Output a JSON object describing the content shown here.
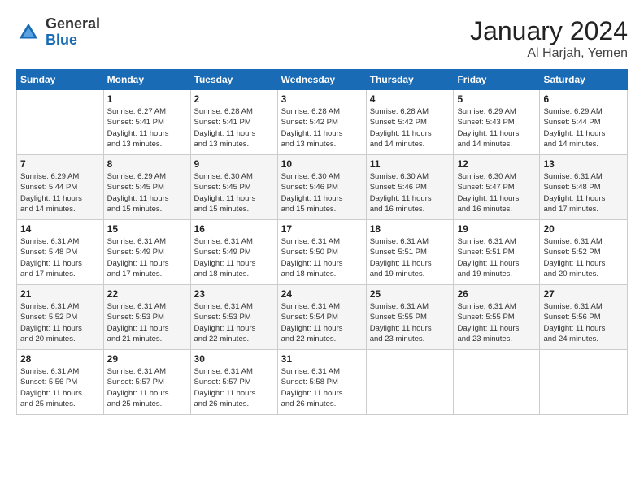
{
  "logo": {
    "general": "General",
    "blue": "Blue"
  },
  "header": {
    "title": "January 2024",
    "subtitle": "Al Harjah, Yemen"
  },
  "columns": [
    "Sunday",
    "Monday",
    "Tuesday",
    "Wednesday",
    "Thursday",
    "Friday",
    "Saturday"
  ],
  "weeks": [
    [
      {
        "day": "",
        "info": ""
      },
      {
        "day": "1",
        "info": "Sunrise: 6:27 AM\nSunset: 5:41 PM\nDaylight: 11 hours\nand 13 minutes."
      },
      {
        "day": "2",
        "info": "Sunrise: 6:28 AM\nSunset: 5:41 PM\nDaylight: 11 hours\nand 13 minutes."
      },
      {
        "day": "3",
        "info": "Sunrise: 6:28 AM\nSunset: 5:42 PM\nDaylight: 11 hours\nand 13 minutes."
      },
      {
        "day": "4",
        "info": "Sunrise: 6:28 AM\nSunset: 5:42 PM\nDaylight: 11 hours\nand 14 minutes."
      },
      {
        "day": "5",
        "info": "Sunrise: 6:29 AM\nSunset: 5:43 PM\nDaylight: 11 hours\nand 14 minutes."
      },
      {
        "day": "6",
        "info": "Sunrise: 6:29 AM\nSunset: 5:44 PM\nDaylight: 11 hours\nand 14 minutes."
      }
    ],
    [
      {
        "day": "7",
        "info": "Sunrise: 6:29 AM\nSunset: 5:44 PM\nDaylight: 11 hours\nand 14 minutes."
      },
      {
        "day": "8",
        "info": "Sunrise: 6:29 AM\nSunset: 5:45 PM\nDaylight: 11 hours\nand 15 minutes."
      },
      {
        "day": "9",
        "info": "Sunrise: 6:30 AM\nSunset: 5:45 PM\nDaylight: 11 hours\nand 15 minutes."
      },
      {
        "day": "10",
        "info": "Sunrise: 6:30 AM\nSunset: 5:46 PM\nDaylight: 11 hours\nand 15 minutes."
      },
      {
        "day": "11",
        "info": "Sunrise: 6:30 AM\nSunset: 5:46 PM\nDaylight: 11 hours\nand 16 minutes."
      },
      {
        "day": "12",
        "info": "Sunrise: 6:30 AM\nSunset: 5:47 PM\nDaylight: 11 hours\nand 16 minutes."
      },
      {
        "day": "13",
        "info": "Sunrise: 6:31 AM\nSunset: 5:48 PM\nDaylight: 11 hours\nand 17 minutes."
      }
    ],
    [
      {
        "day": "14",
        "info": "Sunrise: 6:31 AM\nSunset: 5:48 PM\nDaylight: 11 hours\nand 17 minutes."
      },
      {
        "day": "15",
        "info": "Sunrise: 6:31 AM\nSunset: 5:49 PM\nDaylight: 11 hours\nand 17 minutes."
      },
      {
        "day": "16",
        "info": "Sunrise: 6:31 AM\nSunset: 5:49 PM\nDaylight: 11 hours\nand 18 minutes."
      },
      {
        "day": "17",
        "info": "Sunrise: 6:31 AM\nSunset: 5:50 PM\nDaylight: 11 hours\nand 18 minutes."
      },
      {
        "day": "18",
        "info": "Sunrise: 6:31 AM\nSunset: 5:51 PM\nDaylight: 11 hours\nand 19 minutes."
      },
      {
        "day": "19",
        "info": "Sunrise: 6:31 AM\nSunset: 5:51 PM\nDaylight: 11 hours\nand 19 minutes."
      },
      {
        "day": "20",
        "info": "Sunrise: 6:31 AM\nSunset: 5:52 PM\nDaylight: 11 hours\nand 20 minutes."
      }
    ],
    [
      {
        "day": "21",
        "info": "Sunrise: 6:31 AM\nSunset: 5:52 PM\nDaylight: 11 hours\nand 20 minutes."
      },
      {
        "day": "22",
        "info": "Sunrise: 6:31 AM\nSunset: 5:53 PM\nDaylight: 11 hours\nand 21 minutes."
      },
      {
        "day": "23",
        "info": "Sunrise: 6:31 AM\nSunset: 5:53 PM\nDaylight: 11 hours\nand 22 minutes."
      },
      {
        "day": "24",
        "info": "Sunrise: 6:31 AM\nSunset: 5:54 PM\nDaylight: 11 hours\nand 22 minutes."
      },
      {
        "day": "25",
        "info": "Sunrise: 6:31 AM\nSunset: 5:55 PM\nDaylight: 11 hours\nand 23 minutes."
      },
      {
        "day": "26",
        "info": "Sunrise: 6:31 AM\nSunset: 5:55 PM\nDaylight: 11 hours\nand 23 minutes."
      },
      {
        "day": "27",
        "info": "Sunrise: 6:31 AM\nSunset: 5:56 PM\nDaylight: 11 hours\nand 24 minutes."
      }
    ],
    [
      {
        "day": "28",
        "info": "Sunrise: 6:31 AM\nSunset: 5:56 PM\nDaylight: 11 hours\nand 25 minutes."
      },
      {
        "day": "29",
        "info": "Sunrise: 6:31 AM\nSunset: 5:57 PM\nDaylight: 11 hours\nand 25 minutes."
      },
      {
        "day": "30",
        "info": "Sunrise: 6:31 AM\nSunset: 5:57 PM\nDaylight: 11 hours\nand 26 minutes."
      },
      {
        "day": "31",
        "info": "Sunrise: 6:31 AM\nSunset: 5:58 PM\nDaylight: 11 hours\nand 26 minutes."
      },
      {
        "day": "",
        "info": ""
      },
      {
        "day": "",
        "info": ""
      },
      {
        "day": "",
        "info": ""
      }
    ]
  ]
}
